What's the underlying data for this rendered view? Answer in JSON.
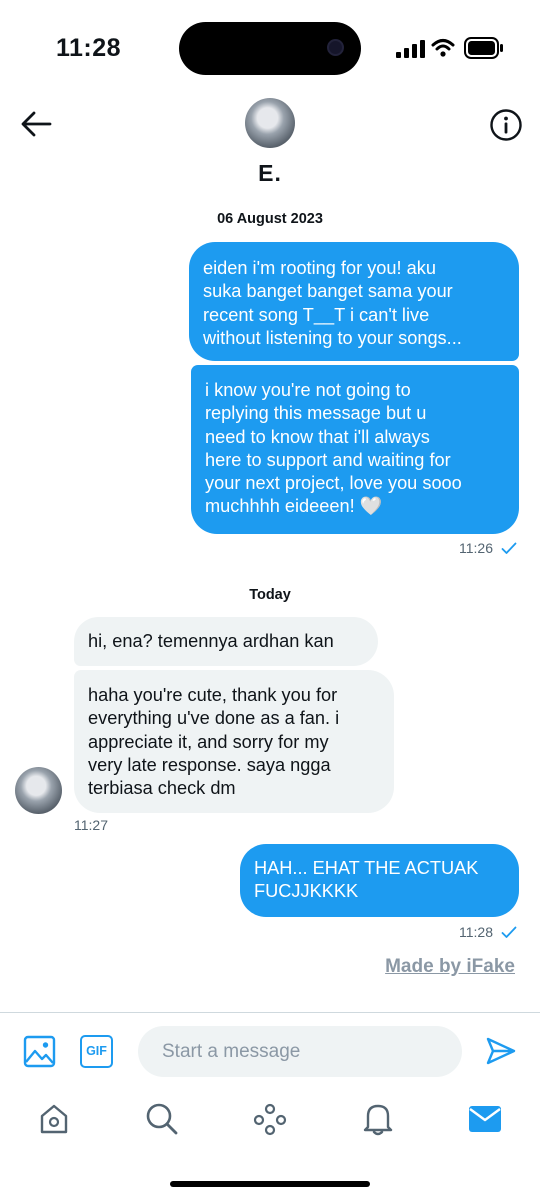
{
  "status_bar": {
    "time": "11:28"
  },
  "header": {
    "name": "E."
  },
  "messages": [
    {
      "date": "06 August 2023"
    },
    {
      "text": "eiden i'm rooting for you! aku suka banget banget sama your recent song T__T i can't live without listening to your songs..."
    },
    {
      "text": "i know you're not going to replying this message but u need to know that i'll always here to support and waiting for your next project, love you sooo muchhhh eideeen! 🤍"
    },
    {
      "time": "11:26"
    },
    {
      "date": "Today"
    },
    {
      "text": "hi, ena? temennya ardhan kan"
    },
    {
      "text": "haha you're cute, thank you for everything u've done as a fan. i appreciate it, and sorry for my very late response. saya ngga terbiasa check dm"
    },
    {
      "time": "11:27"
    },
    {
      "text": "HAH... EHAT THE ACTUAK FUCJJKKKK"
    },
    {
      "time": "11:28"
    }
  ],
  "lines": {
    "m1": [
      "eiden i'm rooting for you! aku",
      "suka banget banget sama your",
      "recent song T__T i can't live",
      "without listening to your songs..."
    ],
    "m2": [
      "i know you're not going to",
      "replying this message but u",
      "need to know that i'll always",
      "here to support and waiting for",
      "your next project, love you sooo",
      "muchhhh eideeen! 🤍"
    ],
    "m3": [
      "hi, ena? temennya ardhan kan"
    ],
    "m4": [
      "haha you're cute, thank you for",
      "everything u've done as a fan. i",
      "appreciate it, and sorry for my",
      "very late response. saya ngga",
      "terbiasa check dm"
    ],
    "m5": [
      "HAH... EHAT THE ACTUAK",
      "FUCJJKKKK"
    ]
  },
  "watermark": "Made by iFake",
  "composer": {
    "placeholder": "Start a message",
    "gif_label": "GIF"
  },
  "colors": {
    "accent": "#1d9bf0",
    "incoming_bubble": "#eff3f4",
    "meta_text": "#536471"
  },
  "icons": [
    "back-arrow-icon",
    "info-icon",
    "image-icon",
    "gif-icon",
    "send-icon",
    "home-icon",
    "search-icon",
    "spaces-icon",
    "notifications-bell-icon",
    "messages-mail-icon"
  ]
}
